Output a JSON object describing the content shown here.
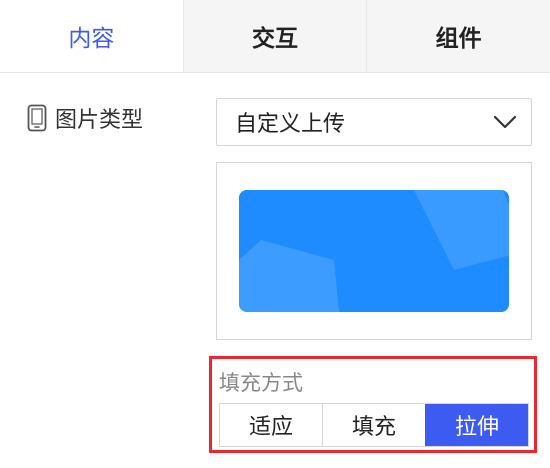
{
  "tabs": [
    {
      "label": "内容",
      "active": true
    },
    {
      "label": "交互",
      "active": false
    },
    {
      "label": "组件",
      "active": false
    }
  ],
  "image_type": {
    "label": "图片类型",
    "icon": "phone-icon",
    "selected": "自定义上传"
  },
  "fill_mode": {
    "title": "填充方式",
    "options": [
      "适应",
      "填充",
      "拉伸"
    ],
    "selected": "拉伸"
  },
  "colors": {
    "accent": "#3d5af1",
    "preview": "#1e8cff",
    "highlight": "#e8292f"
  }
}
